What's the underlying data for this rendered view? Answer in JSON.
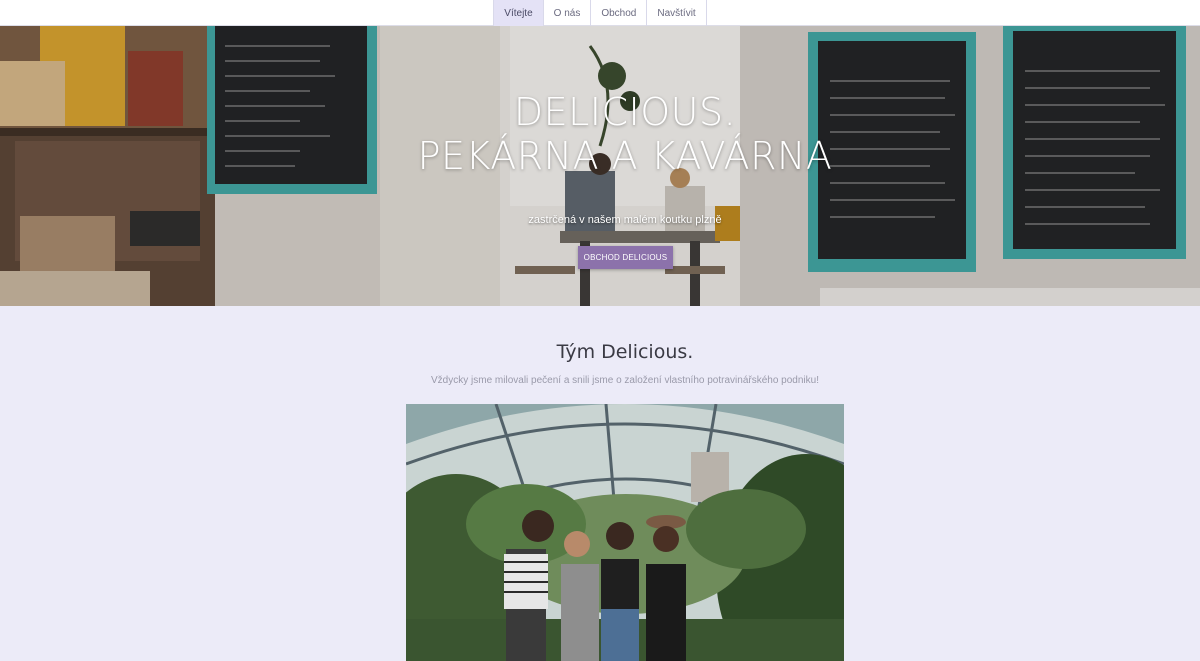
{
  "nav": {
    "items": [
      {
        "label": "Vítejte",
        "active": true
      },
      {
        "label": "O nás",
        "active": false
      },
      {
        "label": "Obchod",
        "active": false
      },
      {
        "label": "Navštívit",
        "active": false
      }
    ]
  },
  "hero": {
    "title_line1": "DELICIOUS.",
    "title_line2": "PEKÁRNA A KAVÁRNA",
    "subtitle": "zastrčená v našem malém koutku plzně",
    "button_label": "OBCHOD DELICIOUS",
    "button_color": "#8c72ab"
  },
  "team": {
    "title": "Tým Delicious.",
    "subtitle": "Vždycky jsme milovali pečení a snili jsme o založení vlastního potravinářského podniku!"
  },
  "colors": {
    "page_bg": "#ecebf8",
    "nav_active_bg": "#e4e2f6"
  }
}
